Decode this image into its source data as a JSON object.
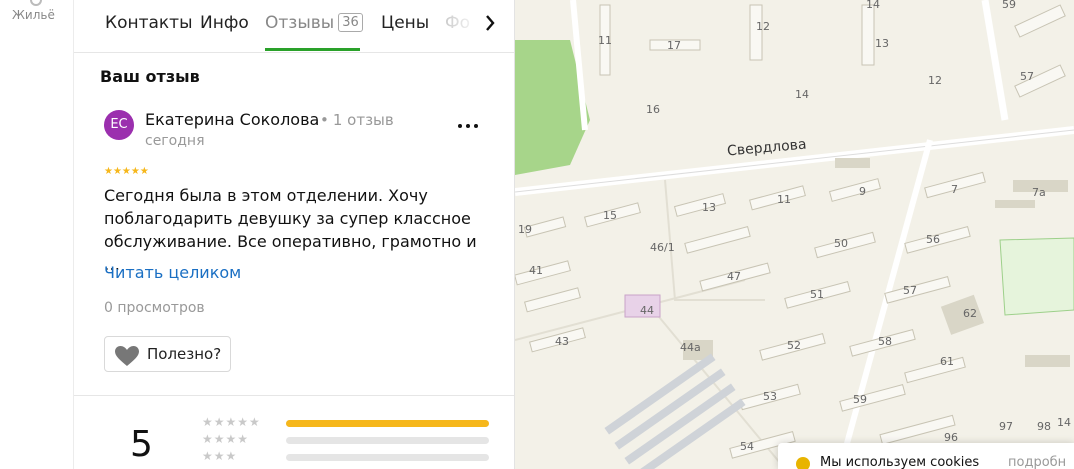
{
  "rail": {
    "label": "Жильё"
  },
  "tabs": [
    {
      "label": "Контакты"
    },
    {
      "label": "Инфо"
    },
    {
      "label": "Отзывы",
      "count": "36"
    },
    {
      "label": "Цены"
    },
    {
      "label": "Фо"
    }
  ],
  "review": {
    "section_title": "Ваш отзыв",
    "avatar_initials": "ЕС",
    "author": "Екатерина Соколова",
    "author_reviews": "1 отзыв",
    "date": "сегодня",
    "rating": 5,
    "text": "Сегодня была в этом отделении. Хочу поблагодарить девушку за супер классное обслуживание. Все оперативно, грамотно и …",
    "read_more": "Читать целиком",
    "views": "0 просмотров",
    "useful_label": "Полезно?"
  },
  "summary": {
    "score": "5",
    "distribution": [
      {
        "stars": 5,
        "fill": 1.0
      },
      {
        "stars": 4,
        "fill": 0.0
      },
      {
        "stars": 3,
        "fill": 0.0
      }
    ]
  },
  "map": {
    "street": "Свердлова",
    "labels": [
      "11",
      "17",
      "12",
      "14",
      "13",
      "59",
      "57",
      "12",
      "16",
      "14",
      "7а",
      "9",
      "7",
      "15",
      "13",
      "11",
      "19",
      "46/1",
      "50",
      "56",
      "41",
      "47",
      "51",
      "57",
      "62",
      "44",
      "43",
      "44а",
      "52",
      "58",
      "61",
      "53",
      "59",
      "54",
      "96",
      "97",
      "98",
      "14"
    ]
  },
  "cookie": {
    "text": "Мы используем cookies",
    "more": "подробн"
  },
  "colors": {
    "accent": "#2aa12a",
    "link": "#1a6fc3",
    "star": "#f6b71b",
    "avatar": "#9b2fae"
  }
}
